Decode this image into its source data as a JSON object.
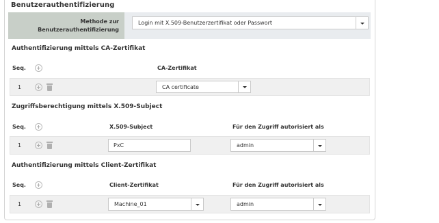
{
  "title": "Benutzerauthentifizierung",
  "method": {
    "label_line1": "Methode zur",
    "label_line2": "Benutzerauthentifizierung",
    "value": "Login mit X.509-Benutzerzertifikat oder Passwort"
  },
  "ca_section": {
    "title": "Authentifizierung mittels CA-Zertifikat",
    "seq_header": "Seq.",
    "col_header": "CA-Zertifikat",
    "rows": [
      {
        "seq": "1",
        "certificate": "CA certificate"
      }
    ]
  },
  "subject_section": {
    "title": "Zugriffsberechtigung mittels X.509-Subject",
    "seq_header": "Seq.",
    "col_subject": "X.509-Subject",
    "col_authorized": "Für den Zugriff autorisiert als",
    "rows": [
      {
        "seq": "1",
        "subject": "PxC",
        "authorized": "admin"
      }
    ]
  },
  "client_section": {
    "title": "Authentifizierung mittels Client-Zertifikat",
    "seq_header": "Seq.",
    "col_certificate": "Client-Zertifikat",
    "col_authorized": "Für den Zugriff autorisiert als",
    "rows": [
      {
        "seq": "1",
        "certificate": "Machine_01",
        "authorized": "admin"
      }
    ]
  },
  "icons": {
    "add": "plus-circle-icon",
    "delete": "trash-icon",
    "dropdown": "chevron-down-icon"
  },
  "colors": {
    "label_bg": "#c8cfc8",
    "row_bg": "#f0f0f0",
    "border": "#c9c9c9"
  }
}
